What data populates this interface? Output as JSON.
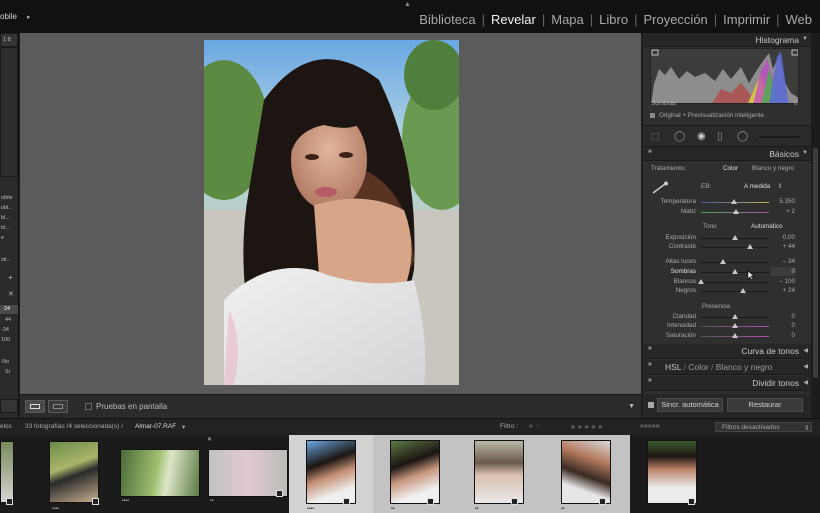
{
  "app": {
    "logo_text": "obile",
    "modules": [
      "Biblioteca",
      "Revelar",
      "Mapa",
      "Libro",
      "Proyección",
      "Imprimir",
      "Web"
    ],
    "active_module": "Revelar"
  },
  "left_panel": {
    "top_value": "1:8",
    "presets": [
      "obile",
      "obl...",
      "bl...",
      "bl...",
      "e"
    ],
    "extra_label": "sti...",
    "values": [
      "24",
      "44",
      "-34",
      "100"
    ],
    "bottom_labels": [
      "No",
      "Si"
    ]
  },
  "toolbar": {
    "soft_proof_label": "Pruebas en pantalla"
  },
  "histogram": {
    "title": "Histograma",
    "shadows_label": "Sombras",
    "shadows_value": "0",
    "preview_label": "Original + Previsualización inteligente"
  },
  "basic": {
    "title": "Básicos",
    "treatment_label": "Tratamiento:",
    "treatment_color": "Color",
    "treatment_bw": "Blanco y negro",
    "wb_label": "EB:",
    "wb_value": "A medida",
    "temperature": {
      "label": "Temperatura",
      "value": "5.350",
      "pos": 0.48
    },
    "tint": {
      "label": "Matiz",
      "value": "+ 2",
      "pos": 0.52
    },
    "tone_label": "Tono",
    "auto_label": "Automático",
    "exposure": {
      "label": "Exposición",
      "value": "0,00",
      "pos": 0.5
    },
    "contrast": {
      "label": "Contraste",
      "value": "+ 44",
      "pos": 0.72
    },
    "highlights": {
      "label": "Altas luces",
      "value": "– 34",
      "pos": 0.33
    },
    "shadows": {
      "label": "Sombras",
      "value": "0",
      "pos": 0.5
    },
    "whites": {
      "label": "Blancos",
      "value": "– 100",
      "pos": 0.0
    },
    "blacks": {
      "label": "Negros",
      "value": "+ 24",
      "pos": 0.62
    },
    "presence_label": "Presencia",
    "clarity": {
      "label": "Claridad",
      "value": "0",
      "pos": 0.5
    },
    "vibrance": {
      "label": "Intensidad",
      "value": "0",
      "pos": 0.5
    },
    "saturation": {
      "label": "Saturación",
      "value": "0",
      "pos": 0.5
    }
  },
  "collapsed_panels": {
    "tone_curve": "Curva de tonos",
    "hsl": "HSL",
    "color": "Color",
    "bw": "Blanco y negro",
    "split_toning": "Dividir tonos"
  },
  "bottom_buttons": {
    "sync": "Sincr. automática",
    "reset": "Restaurar"
  },
  "filmstrip": {
    "left_label": "elos",
    "count_text": "33 fotografías /4 seleccionada(s) /",
    "filename": "Almar-07.RAF",
    "filter_label": "Filtro :",
    "filter_state": "Filtros desactivados"
  },
  "thumbnails": [
    {
      "stars": "",
      "selected": false
    },
    {
      "stars": "••••",
      "selected": false
    },
    {
      "stars": "••••",
      "selected": false
    },
    {
      "stars": "••",
      "selected": false
    },
    {
      "stars": "••••",
      "selected": true
    },
    {
      "stars": "••",
      "selected": true
    },
    {
      "stars": "••",
      "selected": true
    },
    {
      "stars": "••",
      "selected": true
    },
    {
      "stars": "",
      "selected": false
    }
  ],
  "colors": {
    "accent_active": "#f2f2f2",
    "panel_bg": "#2f2f2f",
    "canvas_bg": "#5b5b5b"
  }
}
